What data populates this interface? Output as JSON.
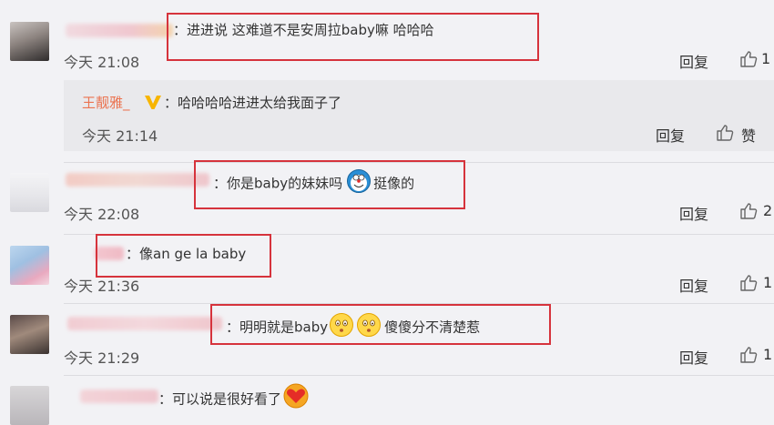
{
  "comments": [
    {
      "text": "：进进说 这难道不是安周拉baby嘛 哈哈哈",
      "time": "今天 21:08",
      "reply": "回复"
    },
    {
      "author": "王靓雅_",
      "text": "：哈哈哈哈进进太给我面子了",
      "time": "今天 21:14",
      "reply": "回复",
      "like_label": "赞"
    },
    {
      "text_before": "：你是baby的妹妹吗",
      "text_after": "挺像的",
      "time": "今天 22:08",
      "reply": "回复",
      "likes": "2"
    },
    {
      "text": "：像an ge la baby",
      "time": "今天 21:36",
      "reply": "回复"
    },
    {
      "text_before": "：明明就是baby",
      "text_after": "傻傻分不清楚惹",
      "time": "今天 21:29",
      "reply": "回复"
    },
    {
      "text": "：可以说是很好看了"
    }
  ],
  "colors": {
    "highlight_box": "#d6333c",
    "vip_name": "#eb7350",
    "vip_badge": "#f7b500"
  }
}
